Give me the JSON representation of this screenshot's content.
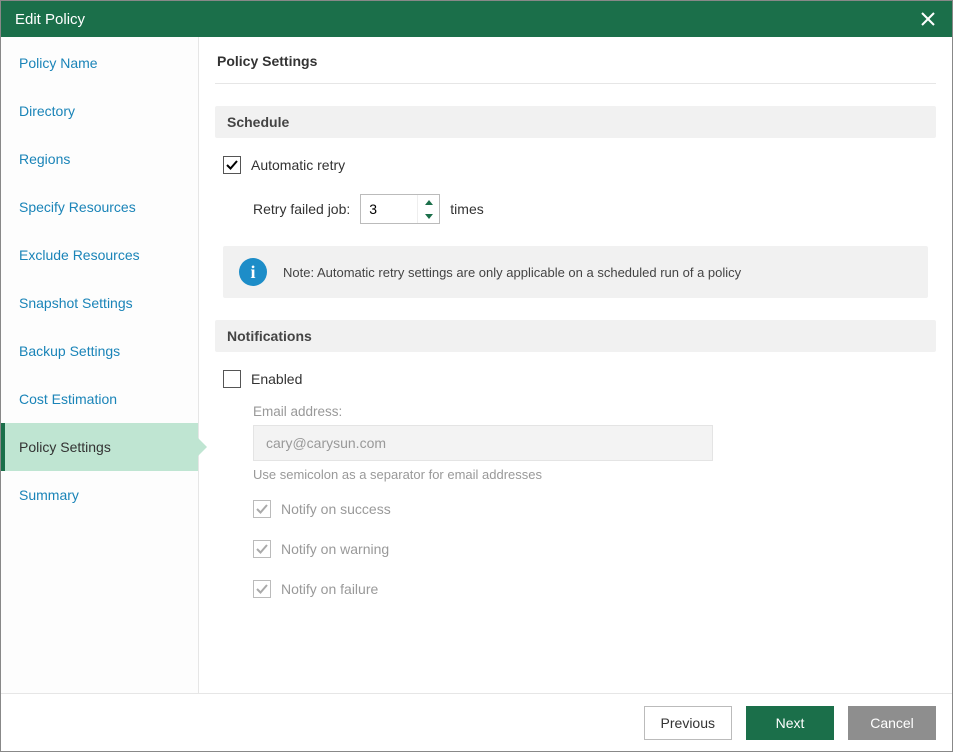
{
  "window": {
    "title": "Edit Policy"
  },
  "sidebar": {
    "items": [
      {
        "label": "Policy Name",
        "active": false
      },
      {
        "label": "Directory",
        "active": false
      },
      {
        "label": "Regions",
        "active": false
      },
      {
        "label": "Specify Resources",
        "active": false
      },
      {
        "label": "Exclude Resources",
        "active": false
      },
      {
        "label": "Snapshot Settings",
        "active": false
      },
      {
        "label": "Backup Settings",
        "active": false
      },
      {
        "label": "Cost Estimation",
        "active": false
      },
      {
        "label": "Policy Settings",
        "active": true
      },
      {
        "label": "Summary",
        "active": false
      }
    ]
  },
  "page": {
    "title": "Policy Settings",
    "schedule": {
      "section_title": "Schedule",
      "auto_retry": {
        "label": "Automatic retry",
        "checked": true
      },
      "retry_label": "Retry failed job:",
      "retry_value": "3",
      "retry_suffix": "times",
      "note": "Note: Automatic retry settings are only applicable on a scheduled run of a policy"
    },
    "notifications": {
      "section_title": "Notifications",
      "enabled": {
        "label": "Enabled",
        "checked": false
      },
      "email_label": "Email address:",
      "email_value": "cary@carysun.com",
      "email_hint": "Use semicolon as a separator for email addresses",
      "notify_success": {
        "label": "Notify on success",
        "checked": true
      },
      "notify_warning": {
        "label": "Notify on warning",
        "checked": true
      },
      "notify_failure": {
        "label": "Notify on failure",
        "checked": true
      }
    }
  },
  "footer": {
    "previous": "Previous",
    "next": "Next",
    "cancel": "Cancel"
  }
}
